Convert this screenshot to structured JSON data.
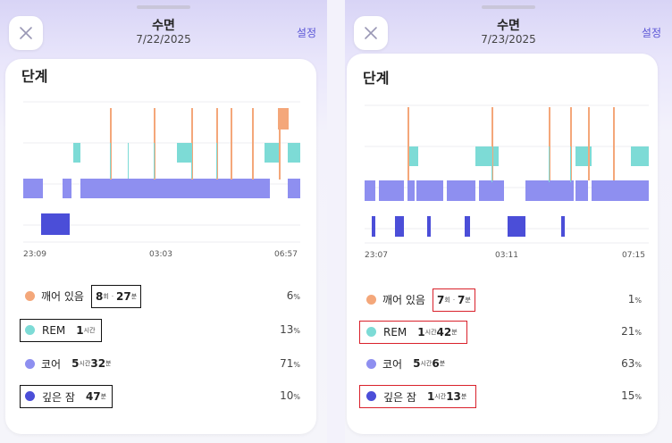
{
  "panels": [
    {
      "header": {
        "title": "수면",
        "date": "7/22/2025",
        "settings": "설정"
      },
      "card_title": "단계",
      "x_ticks": [
        "23:09",
        "03:03",
        "06:57"
      ],
      "legend": [
        {
          "name": "깨어 있음",
          "v1": "8",
          "u1": "회",
          "sep": "·",
          "v2": "27",
          "u2": "분",
          "pct": "6",
          "pct_unit": "%"
        },
        {
          "name": "REM",
          "v1": "1",
          "u1": "시간",
          "sep": "",
          "v2": "",
          "u2": "",
          "pct": "13",
          "pct_unit": "%"
        },
        {
          "name": "코어",
          "v1": "5",
          "u1": "시간",
          "sep": "",
          "v2": "32",
          "u2": "분",
          "pct": "71",
          "pct_unit": "%"
        },
        {
          "name": "깊은 잠",
          "v1": "47",
          "u1": "분",
          "sep": "",
          "v2": "",
          "u2": "",
          "pct": "10",
          "pct_unit": "%"
        }
      ]
    },
    {
      "header": {
        "title": "수면",
        "date": "7/23/2025",
        "settings": "설정"
      },
      "card_title": "단계",
      "x_ticks": [
        "23:07",
        "03:11",
        "07:15"
      ],
      "legend": [
        {
          "name": "깨어 있음",
          "v1": "7",
          "u1": "회",
          "sep": "·",
          "v2": "7",
          "u2": "분",
          "pct": "1",
          "pct_unit": "%"
        },
        {
          "name": "REM",
          "v1": "1",
          "u1": "시간",
          "sep": "",
          "v2": "42",
          "u2": "분",
          "pct": "21",
          "pct_unit": "%"
        },
        {
          "name": "코어",
          "v1": "5",
          "u1": "시간",
          "sep": "",
          "v2": "6",
          "u2": "분",
          "pct": "63",
          "pct_unit": "%"
        },
        {
          "name": "깊은 잠",
          "v1": "1",
          "u1": "시간",
          "sep": "",
          "v2": "13",
          "u2": "분",
          "pct": "15",
          "pct_unit": "%"
        }
      ]
    }
  ],
  "stage_colors": {
    "awake": "#f4a77a",
    "rem": "#7ddbd6",
    "core": "#8e8ff0",
    "deep": "#4b4ed8"
  },
  "icons": {
    "close": "close-icon"
  }
}
